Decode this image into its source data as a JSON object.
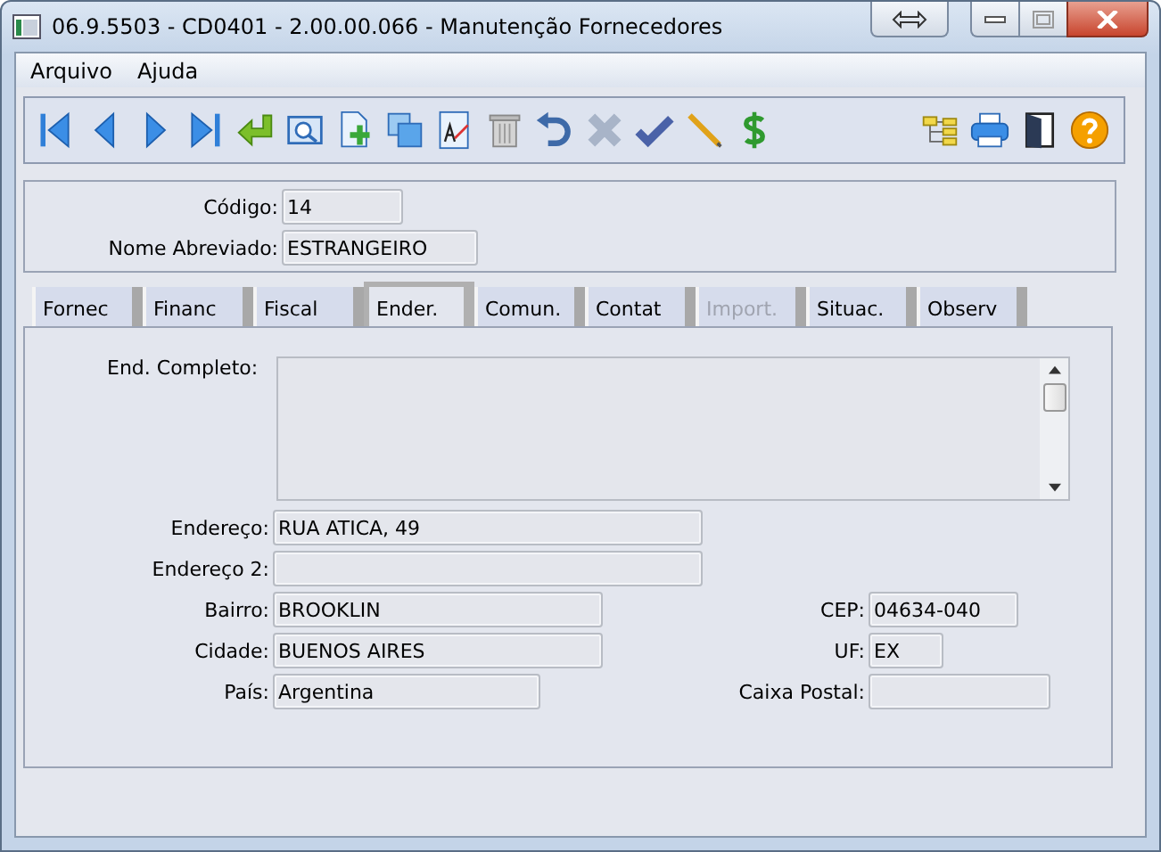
{
  "window": {
    "title": "06.9.5503 - CD0401 - 2.00.00.066 - Manutenção Fornecedores"
  },
  "menu": [
    {
      "label": "Arquivo"
    },
    {
      "label": "Ajuda"
    }
  ],
  "header_fields": [
    {
      "label": "Código:",
      "value": "14"
    },
    {
      "label": "Nome Abreviado:",
      "value": "ESTRANGEIRO"
    }
  ],
  "tabs": [
    {
      "label": "Fornec",
      "selected": false,
      "disabled": false
    },
    {
      "label": "Financ",
      "selected": false,
      "disabled": false
    },
    {
      "label": "Fiscal",
      "selected": false,
      "disabled": false
    },
    {
      "label": "Ender.",
      "selected": true,
      "disabled": false
    },
    {
      "label": "Comun.",
      "selected": false,
      "disabled": false
    },
    {
      "label": "Contat",
      "selected": false,
      "disabled": false
    },
    {
      "label": "Import.",
      "selected": false,
      "disabled": true
    },
    {
      "label": "Situac.",
      "selected": false,
      "disabled": false
    },
    {
      "label": "Observ",
      "selected": false,
      "disabled": false
    }
  ],
  "full_address": {
    "label": "End. Completo:"
  },
  "rows": [
    {
      "left": {
        "label": "Endereço:",
        "value": "RUA ATICA, 49"
      }
    },
    {
      "left": {
        "label": "Endereço 2:"
      }
    },
    {
      "left": {
        "label": "Bairro:",
        "value": "BROOKLIN"
      },
      "right": {
        "label": "CEP:",
        "value": "04634-040"
      }
    },
    {
      "left": {
        "label": "Cidade:",
        "value": "BUENOS AIRES"
      },
      "right": {
        "label": "UF:",
        "value": "EX"
      }
    },
    {
      "left": {
        "label": "País:",
        "value": "Argentina"
      },
      "right": {
        "label": "Caixa Postal:"
      }
    }
  ]
}
